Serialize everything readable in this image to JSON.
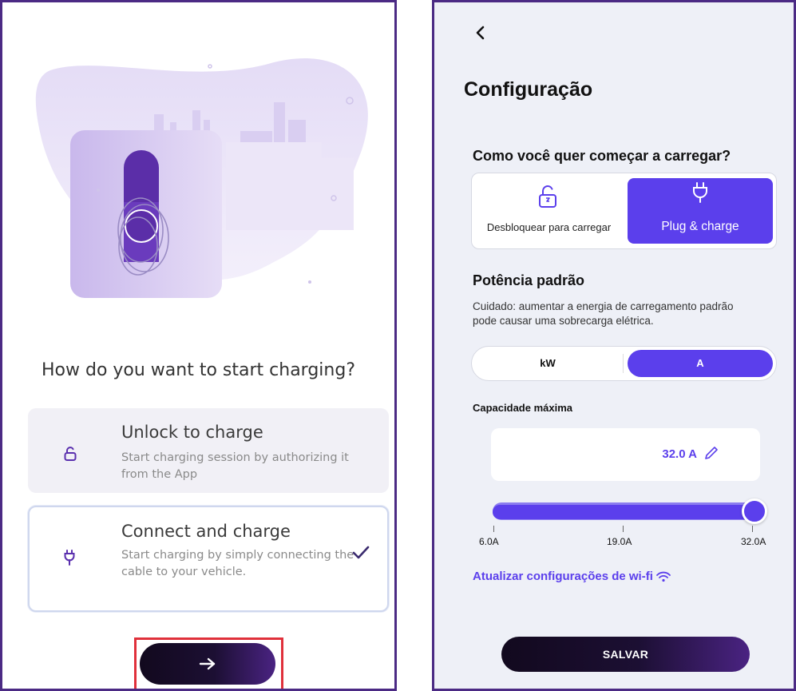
{
  "left_screen": {
    "question": "How do you want to start charging?",
    "options": [
      {
        "title": "Unlock to charge",
        "description": "Start charging session by authorizing it from the App",
        "icon": "unlock-icon",
        "selected": false
      },
      {
        "title": "Connect and charge",
        "description": "Start charging by simply connecting the cable to your vehicle.",
        "icon": "plug-icon",
        "selected": true
      }
    ],
    "next_button_icon": "arrow-right-icon"
  },
  "right_screen": {
    "back_icon": "chevron-left-icon",
    "title": "Configuração",
    "charging_question": "Como você quer começar a carregar?",
    "modes": [
      {
        "label": "Desbloquear para carregar",
        "icon": "unlock-icon",
        "selected": false
      },
      {
        "label": "Plug & charge",
        "icon": "plug-icon",
        "selected": true
      }
    ],
    "power_title": "Potência padrão",
    "power_warning": "Cuidado: aumentar a energia de carregamento padrão pode causar uma sobrecarga elétrica.",
    "units": [
      {
        "label": "kW",
        "selected": false
      },
      {
        "label": "A",
        "selected": true
      }
    ],
    "capacity_label": "Capacidade máxima",
    "capacity_value": "32.0 A",
    "slider": {
      "min_label": "6.0A",
      "mid_label": "19.0A",
      "max_label": "32.0A",
      "min": 6.0,
      "max": 32.0,
      "value": 32.0
    },
    "wifi_link": "Atualizar configurações de wi-fi",
    "save_label": "SALVAR"
  },
  "colors": {
    "accent": "#5b3fec",
    "frame": "#4b2a84",
    "highlight_box": "#e0303b",
    "button_dark": "#12091e"
  }
}
